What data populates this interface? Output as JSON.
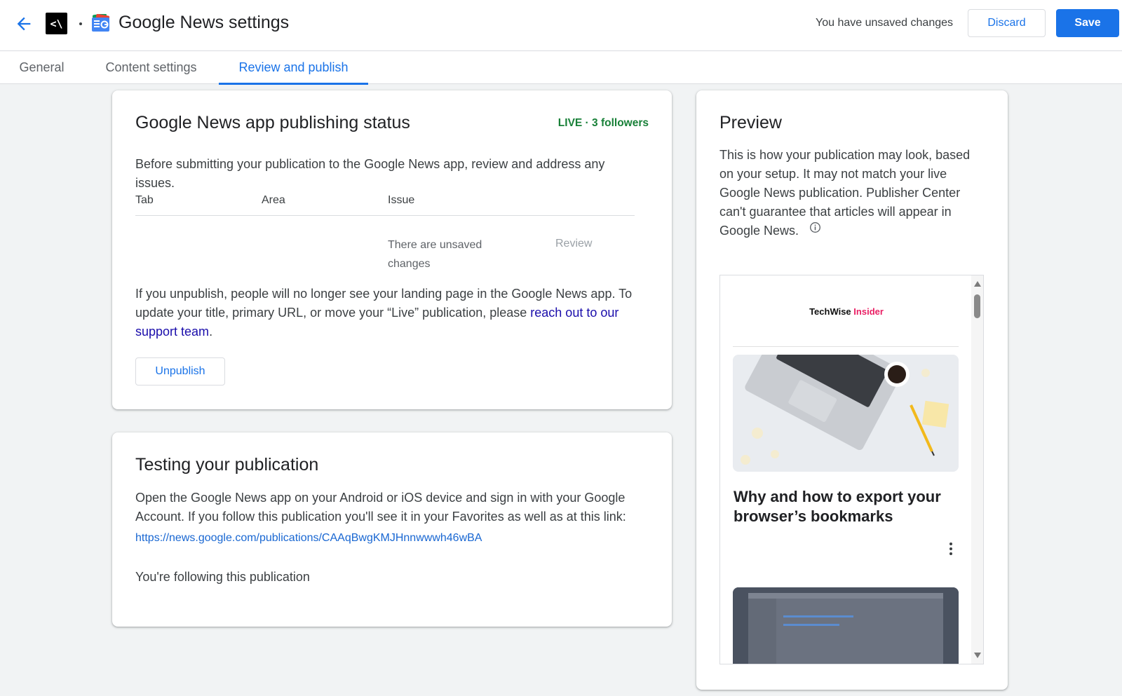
{
  "header": {
    "title": "Google News settings",
    "back_icon": "arrow-left",
    "publication_logo_text": "<\\",
    "unsaved_text": "You have unsaved changes",
    "discard_label": "Discard",
    "save_label": "Save",
    "accent_color": "#1a73e8"
  },
  "tabs": [
    {
      "label": "General"
    },
    {
      "label": "Content settings"
    },
    {
      "label": "Review and publish",
      "active": true
    }
  ],
  "status_card": {
    "title": "Google News app publishing status",
    "status": "LIVE · 3 followers",
    "status_color": "#188038",
    "intro": "Before submitting your publication to the Google News app, review and address any issues.",
    "table": {
      "headers": [
        "Tab",
        "Area",
        "Issue"
      ],
      "rows": [
        {
          "tab": "",
          "area": "",
          "issue": "There are unsaved changes",
          "action": "Review"
        }
      ]
    },
    "unpublish_text": "If you unpublish, people will no longer see your landing page in the Google News app. To update your title, primary URL, or move your “Live” publication, please",
    "support_link": "reach out to our support team",
    "unpublish_suffix": ".",
    "unpublish_label": "Unpublish"
  },
  "testing_card": {
    "title": "Testing your publication",
    "body": "Open the Google News app on your Android or iOS device and sign in with your Google Account. If you follow this publication you'll see it in your Favorites as well as at this link:",
    "link": "https://news.google.com/publications/CAAqBwgKMJHnnwwwh46wBA",
    "following": "You're following this publication"
  },
  "preview_card": {
    "title": "Preview",
    "body": "This is how your publication may look, based on your setup. It may not match your live Google News publication. Publisher Center can't guarantee that articles will appear in Google News.",
    "brand_part1": "TechWise",
    "brand_part2": "Insider",
    "article_title": "Why and how to export your browser’s bookmarks"
  }
}
